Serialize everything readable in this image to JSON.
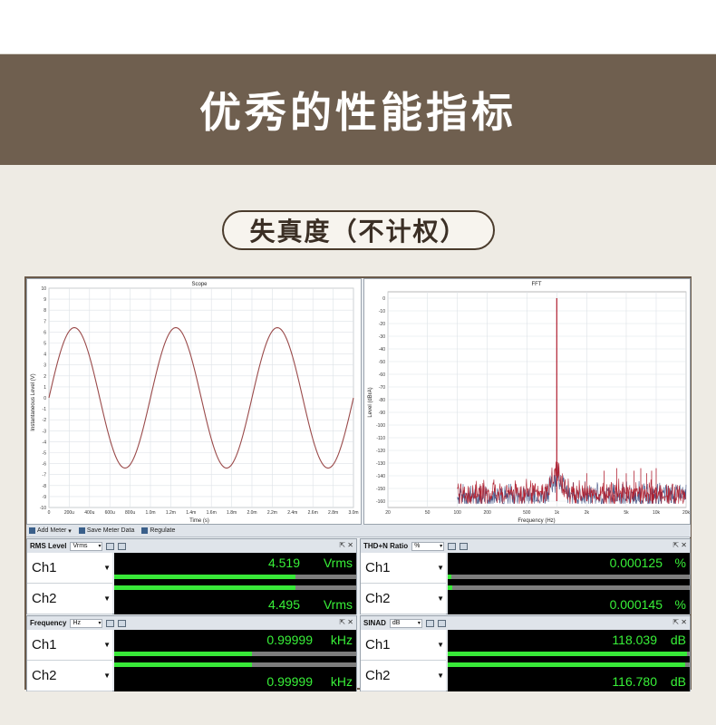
{
  "banner": {
    "title": "优秀的性能指标"
  },
  "section": {
    "title": "失真度（不计权）"
  },
  "colors": {
    "banner_bg": "#6f5f4f",
    "meter_green": "#38f038",
    "fft_red": "#b02030",
    "fft_blue": "#4a5a8a",
    "scope_trace": "#9a4a4a"
  },
  "scope": {
    "title": "Scope",
    "xlabel": "Time (s)",
    "ylabel": "Instantaneous Level (V)",
    "xticks": [
      "0",
      "200u",
      "400u",
      "600u",
      "800u",
      "1.0m",
      "1.2m",
      "1.4m",
      "1.6m",
      "1.8m",
      "2.0m",
      "2.2m",
      "2.4m",
      "2.6m",
      "2.8m",
      "3.0m"
    ],
    "yticks": [
      "10",
      "9",
      "8",
      "7",
      "6",
      "5",
      "4",
      "3",
      "2",
      "1",
      "0",
      "-1",
      "-2",
      "-3",
      "-4",
      "-5",
      "-6",
      "-7",
      "-8",
      "-9",
      "-10"
    ]
  },
  "fft": {
    "title": "FFT",
    "xlabel": "Frequency (Hz)",
    "ylabel": "Level (dBrA)",
    "xticks": [
      "20",
      "50",
      "100",
      "200",
      "500",
      "1k",
      "2k",
      "5k",
      "10k",
      "20k"
    ],
    "yticks": [
      "0",
      "-10",
      "-20",
      "-30",
      "-40",
      "-50",
      "-60",
      "-70",
      "-80",
      "-90",
      "-100",
      "-110",
      "-120",
      "-130",
      "-140",
      "-150",
      "-160"
    ]
  },
  "toolbar": {
    "add_meter": "Add Meter",
    "save_meter_data": "Save Meter Data",
    "regulate": "Regulate"
  },
  "meters": {
    "rms": {
      "title": "RMS Level",
      "unit": "Vrms",
      "ch1_label": "Ch1",
      "ch2_label": "Ch2",
      "ch1_value": "4.519",
      "ch2_value": "4.495",
      "ch1_unit": "Vrms",
      "ch2_unit": "Vrms",
      "ch1_fill": 0.75,
      "ch2_fill": 0.75
    },
    "thdn": {
      "title": "THD+N Ratio",
      "unit": "%",
      "ch1_label": "Ch1",
      "ch2_label": "Ch2",
      "ch1_value": "0.000125",
      "ch2_value": "0.000145",
      "ch1_unit": "%",
      "ch2_unit": "%",
      "ch1_fill": 0.015,
      "ch2_fill": 0.02
    },
    "freq": {
      "title": "Frequency",
      "unit": "Hz",
      "ch1_label": "Ch1",
      "ch2_label": "Ch2",
      "ch1_value": "0.99999",
      "ch2_value": "0.99999",
      "ch1_unit": "kHz",
      "ch2_unit": "kHz",
      "ch1_fill": 0.57,
      "ch2_fill": 0.57
    },
    "sinad": {
      "title": "SINAD",
      "unit": "dB",
      "ch1_label": "Ch1",
      "ch2_label": "Ch2",
      "ch1_value": "118.039",
      "ch2_value": "116.780",
      "ch1_unit": "dB",
      "ch2_unit": "dB",
      "ch1_fill": 0.99,
      "ch2_fill": 0.98
    }
  }
}
